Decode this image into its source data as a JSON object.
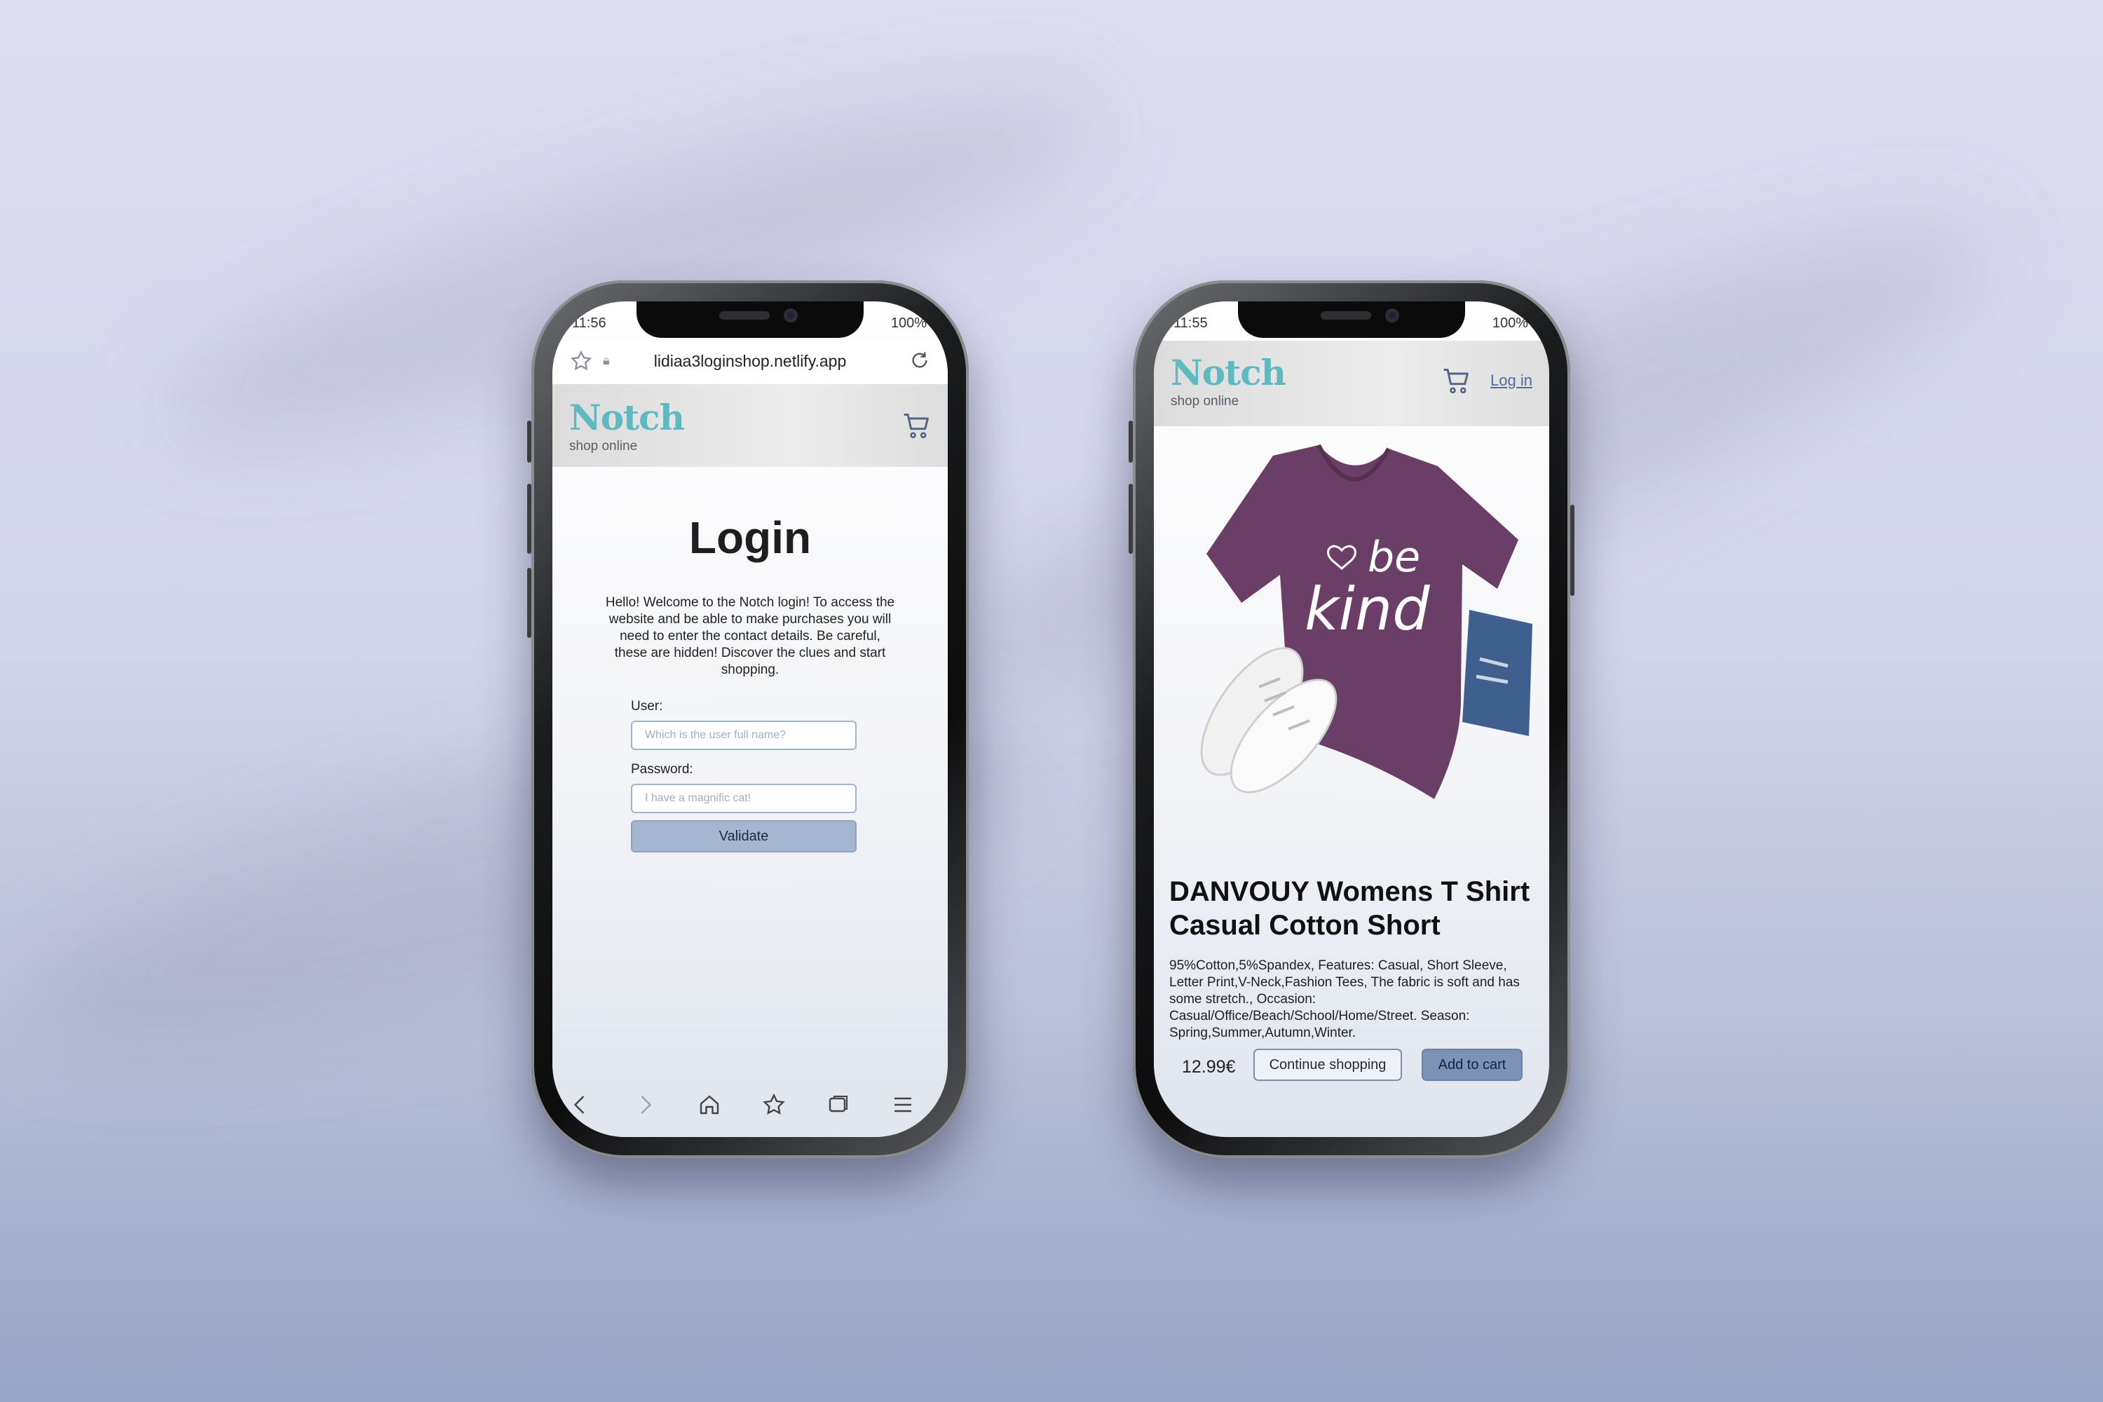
{
  "left_phone": {
    "status": {
      "time": "11:56",
      "battery": "100%"
    },
    "browser": {
      "url": "lidiaa3loginshop.netlify.app"
    },
    "header": {
      "logo": "Notch",
      "tagline": "shop online"
    },
    "login": {
      "title": "Login",
      "intro": "Hello! Welcome to the Notch login! To access the website and be able to make purchases you will need to enter the contact details. Be careful, these are hidden! Discover the clues and start shopping.",
      "user_label": "User:",
      "user_placeholder": "Which is the user full name?",
      "password_label": "Password:",
      "password_placeholder": "I have a magnific cat!",
      "validate_label": "Validate"
    },
    "nav_icons": [
      "back-icon",
      "forward-icon",
      "home-icon",
      "bookmarks-icon",
      "tabs-icon",
      "menu-icon"
    ]
  },
  "right_phone": {
    "status": {
      "time": "11:55",
      "battery": "100%"
    },
    "header": {
      "logo": "Notch",
      "tagline": "shop online",
      "login_link": "Log in"
    },
    "product": {
      "shirt_text_1": "be",
      "shirt_text_2": "kind",
      "title": "DANVOUY Womens T Shirt Casual Cotton Short",
      "description": "95%Cotton,5%Spandex, Features: Casual, Short Sleeve, Letter Print,V-Neck,Fashion Tees, The fabric is soft and has some stretch., Occasion: Casual/Office/Beach/School/Home/Street. Season: Spring,Summer,Autumn,Winter.",
      "price": "12.99€",
      "continue_label": "Continue shopping",
      "add_label": "Add to cart"
    }
  },
  "colors": {
    "brand_teal": "#5fb9c1",
    "button_blue": "#a5b7d0",
    "add_to_cart_blue": "#7d93b6",
    "shirt_purple": "#6b3e68",
    "link_blue": "#4b6fa0"
  }
}
